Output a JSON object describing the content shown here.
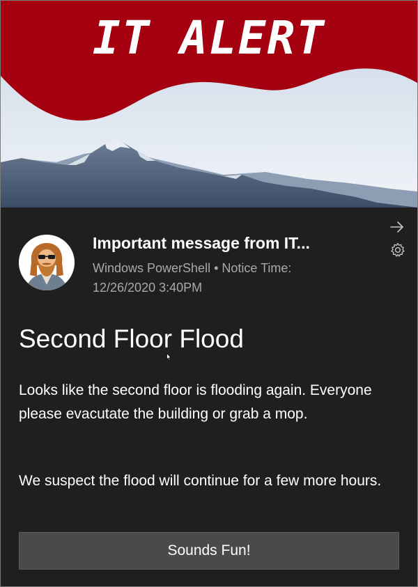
{
  "hero": {
    "text": "IT ALERT",
    "banner_color": "#a50010",
    "image": "mountain-landscape"
  },
  "notification": {
    "header_actions": {
      "expand_icon": "arrow-right-icon",
      "settings_icon": "gear-icon"
    },
    "avatar": "bearded-man-sunglasses-avatar",
    "title": "Important message from IT...",
    "source": "Windows PowerShell • Notice Time:",
    "timestamp": "12/26/2020 3:40PM",
    "content_title": "Second Floor Flood",
    "messages": [
      "Looks like the second floor is flooding again. Everyone please evacutate the building or grab a mop.",
      "We suspect the flood will continue for a few more hours."
    ],
    "button_label": "Sounds Fun!"
  },
  "colors": {
    "background": "#1f1f1f",
    "button": "#4a4a4a",
    "text": "#ffffff",
    "meta_text": "#a9a9a9"
  }
}
